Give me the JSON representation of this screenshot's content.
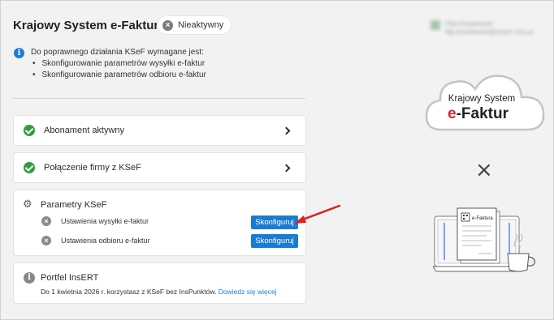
{
  "header": {
    "title": "Krajowy System e-Faktur",
    "status_badge": "Nieaktywny",
    "user_name": "Filip Kowalewski",
    "user_email": "filip.kowalewski@insert.com.pl"
  },
  "info": {
    "heading": "Do poprawnego działania KSeF wymagane jest:",
    "items": [
      "Skonfigurowanie parametrów wysyłki e-faktur",
      "Skonfigurowanie parametrów odbioru e-faktur"
    ]
  },
  "status_rows": [
    {
      "label": "Abonament aktywny",
      "icon": "check-circle-icon"
    },
    {
      "label": "Połączenie firmy z KSeF",
      "icon": "check-circle-icon"
    }
  ],
  "ksef_params": {
    "title": "Parametry KSeF",
    "settings": [
      {
        "label": "Ustawienia wysyłki e-faktur",
        "button": "Skonfiguruj"
      },
      {
        "label": "Ustawienia odbioru e-faktur",
        "button": "Skonfiguruj"
      }
    ]
  },
  "portfel": {
    "title": "Portfel InsERT",
    "text": "Do 1 kwietnia 2026 r. korzystasz z KSeF bez InsPunktów.",
    "link": "Dowiedz się więcej"
  },
  "illustration": {
    "cloud_line1": "Krajowy System",
    "cloud_line2_e": "e",
    "cloud_line2_rest": "-Faktur",
    "laptop_doc_title": "e-Faktura"
  },
  "colors": {
    "accent": "#1a7bd3",
    "success": "#2e9e3f",
    "arrow": "#e0201b",
    "brand_red": "#d9262b"
  }
}
